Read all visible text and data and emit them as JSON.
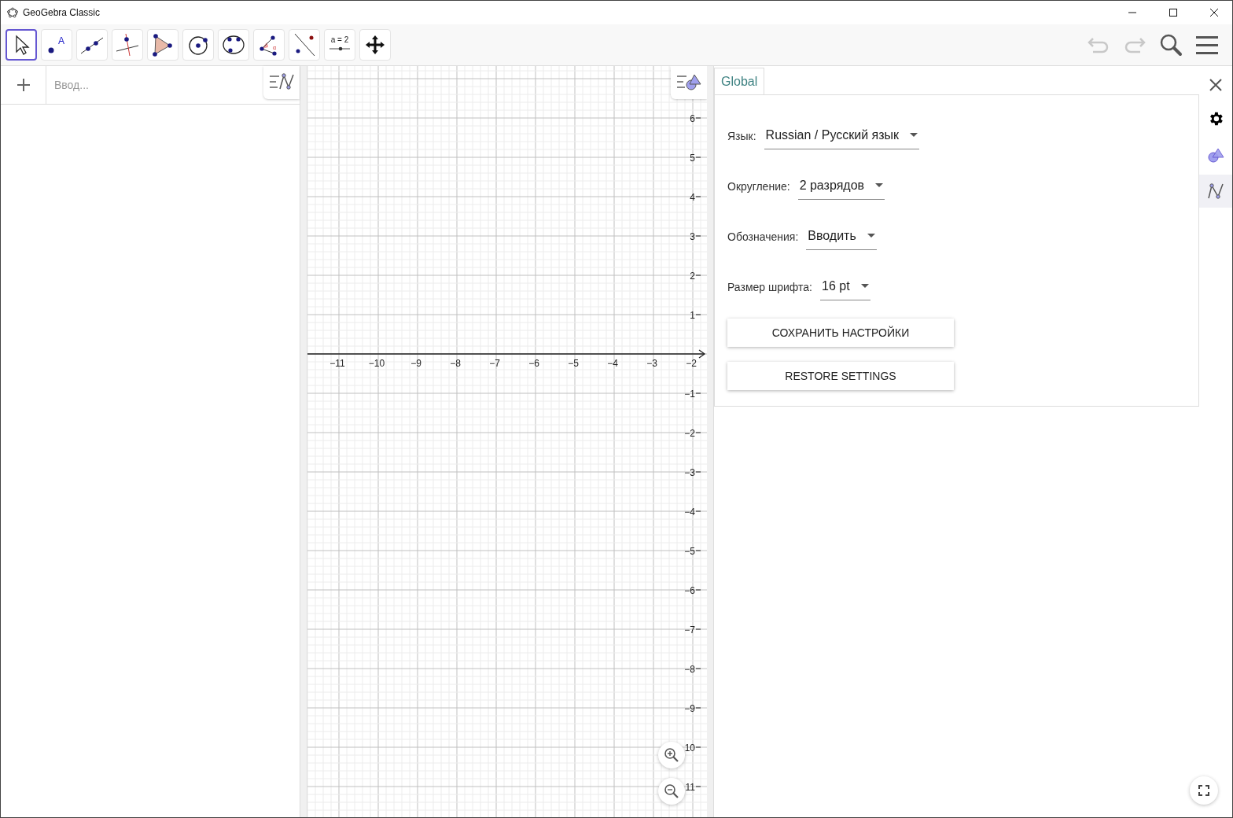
{
  "window": {
    "title": "GeoGebra Classic"
  },
  "tools": [
    {
      "kind": "move",
      "selected": true
    },
    {
      "kind": "point",
      "label": "A",
      "selected": false
    },
    {
      "kind": "line",
      "selected": false
    },
    {
      "kind": "perpendicular",
      "selected": false
    },
    {
      "kind": "polygon",
      "selected": false
    },
    {
      "kind": "circle",
      "selected": false
    },
    {
      "kind": "conic",
      "selected": false
    },
    {
      "kind": "angle",
      "label": "α",
      "selected": false
    },
    {
      "kind": "reflect",
      "selected": false
    },
    {
      "kind": "slider",
      "label": "a = 2",
      "selected": false
    },
    {
      "kind": "pan",
      "selected": false
    }
  ],
  "algebra": {
    "placeholder": "Ввод..."
  },
  "graphics": {
    "x_labels": [
      "−11",
      "−10",
      "−9",
      "−8",
      "−7",
      "−6",
      "−5",
      "−4",
      "−3",
      "−2"
    ],
    "y_labels": [
      "6",
      "5",
      "4",
      "3",
      "2",
      "1",
      "−1",
      "−2",
      "−3",
      "−4",
      "−5",
      "−6",
      "−7",
      "−8",
      "−9",
      "10",
      "11"
    ]
  },
  "settings": {
    "tabs": [
      {
        "label": "Global",
        "selected": true
      }
    ],
    "fields": [
      {
        "label": "Язык:",
        "value": "Russian / Русский язык"
      },
      {
        "label": "Округление:",
        "value": "2 разрядов"
      },
      {
        "label": "Обозначения:",
        "value": "Вводить"
      },
      {
        "label": "Размер шрифта:",
        "value": "16 pt"
      }
    ],
    "buttons": [
      "СОХРАНИТЬ НАСТРОЙКИ",
      "RESTORE SETTINGS"
    ],
    "side_icons": [
      {
        "kind": "gear",
        "selected": true,
        "highlighted": false
      },
      {
        "kind": "shapes",
        "selected": false,
        "highlighted": false
      },
      {
        "kind": "graph",
        "selected": false,
        "highlighted": true
      }
    ]
  }
}
